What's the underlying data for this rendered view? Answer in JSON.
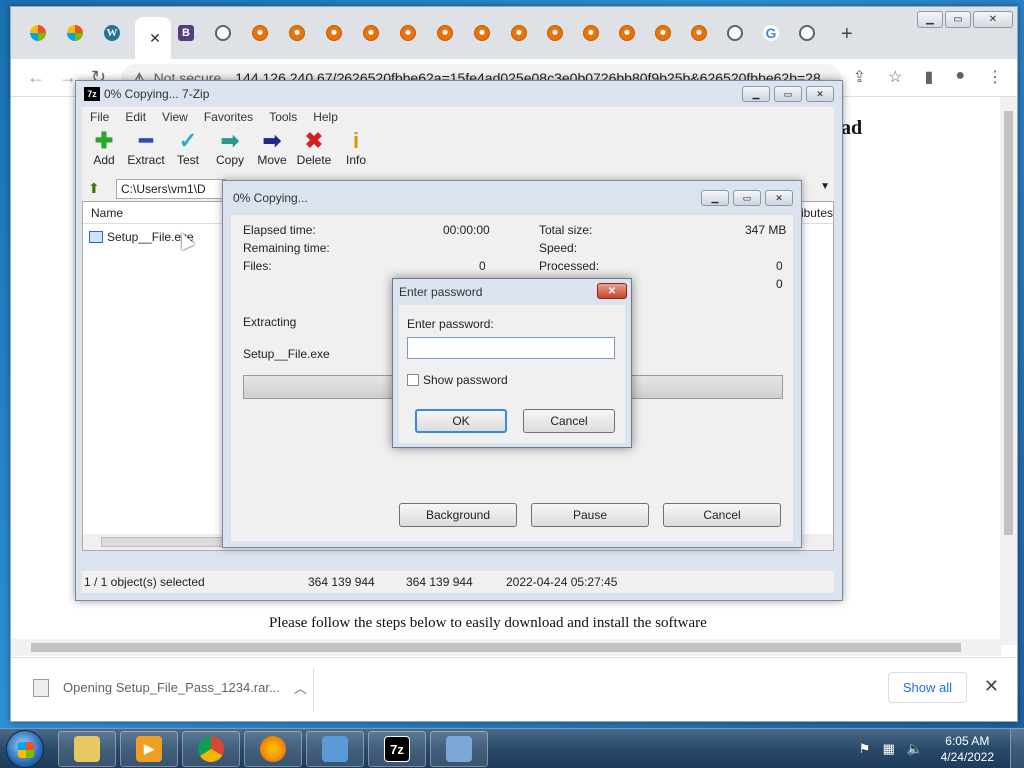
{
  "browser": {
    "omnibox": {
      "security": "Not secure",
      "url": "144.126.240.67/?626520fbbe62a=15fe4ad025e08c3e0b0726bb80f9b25b&626520fbbe62b=28..."
    },
    "page": {
      "heading_fragment": "ad",
      "instruction": "Please follow the steps below to easily download and install the software"
    },
    "download_bar": {
      "item": "Opening Setup_File_Pass_1234.rar...",
      "show_all": "Show all"
    }
  },
  "zip": {
    "title": "0% Copying... 7-Zip",
    "logo": "7z",
    "menu": [
      "File",
      "Edit",
      "View",
      "Favorites",
      "Tools",
      "Help"
    ],
    "toolbar": [
      "Add",
      "Extract",
      "Test",
      "Copy",
      "Move",
      "Delete",
      "Info"
    ],
    "path": "C:\\Users\\vm1\\D",
    "columns": {
      "name": "Name",
      "attributes": "ributes"
    },
    "file": "Setup__File.exe",
    "status": {
      "selected": "1 / 1 object(s) selected",
      "size": "364 139 944",
      "packed": "364 139 944",
      "modified": "2022-04-24 05:27:45"
    }
  },
  "copy_dialog": {
    "title": "0% Copying...",
    "elapsed_label": "Elapsed time:",
    "elapsed_value": "00:00:00",
    "remaining_label": "Remaining time:",
    "files_label": "Files:",
    "files_value": "0",
    "total_label": "Total size:",
    "total_value": "347 MB",
    "speed_label": "Speed:",
    "processed_label": "Processed:",
    "processed_value": "0",
    "extra_value": "0",
    "operation": "Extracting",
    "current_file": "Setup__File.exe",
    "progress_fraction": 0,
    "buttons": {
      "background": "Background",
      "pause": "Pause",
      "cancel": "Cancel"
    }
  },
  "password_dialog": {
    "title": "Enter password",
    "label": "Enter password:",
    "value": "",
    "show_password": "Show password",
    "ok": "OK",
    "cancel": "Cancel"
  },
  "taskbar": {
    "clock_time": "6:05 AM",
    "clock_date": "4/24/2022"
  },
  "colors": {
    "taskbar": "#2a4a6a",
    "dialog_frame": "#dbe3ee",
    "chrome_tabstrip": "#dee1e6",
    "link": "#1a73e8"
  }
}
